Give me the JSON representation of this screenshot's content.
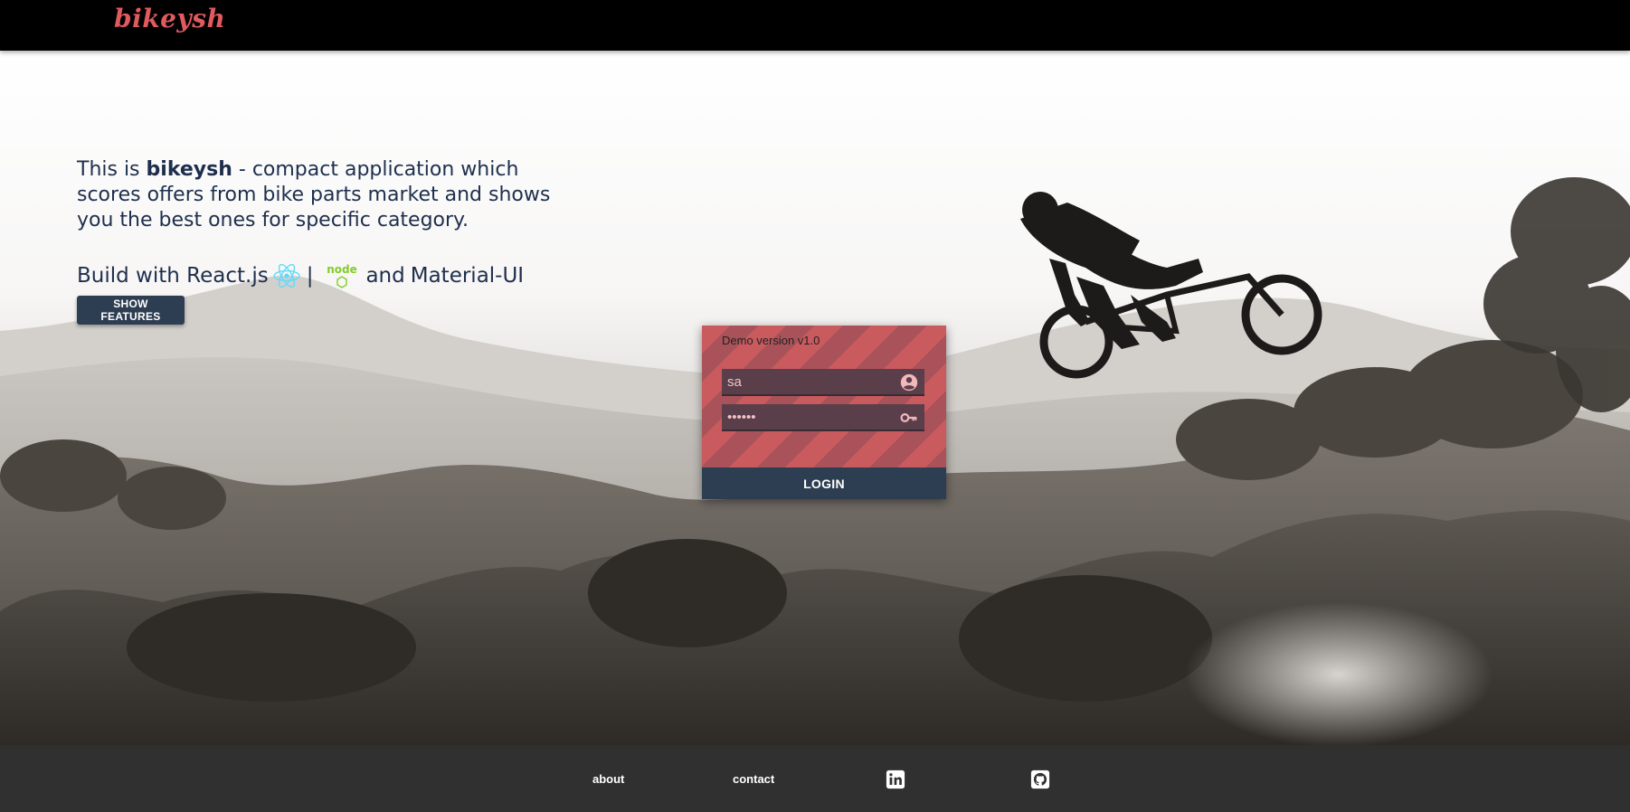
{
  "header": {
    "logo": "bikeysh"
  },
  "hero": {
    "intro_prefix": "This is ",
    "intro_brand": "bikeysh",
    "intro_rest": " - compact application which scores offers from bike parts market and shows you the best ones for specific category.",
    "build_prefix": "Build with React.js",
    "build_sep": "|",
    "build_and": "and",
    "build_mui": "Material-UI",
    "node_logo_text": "node",
    "features_button": "SHOW FEATURES"
  },
  "login": {
    "demo_label": "Demo version v1.0",
    "username_value": "sa",
    "password_value": "••••••",
    "login_button": "LOGIN",
    "username_icon": "account-circle-icon",
    "password_icon": "key-icon"
  },
  "footer": {
    "links": [
      "about",
      "contact"
    ],
    "social_icons": [
      "linkedin-icon",
      "github-icon"
    ]
  },
  "colors": {
    "brand": "#e05a5e",
    "header_bg": "#000000",
    "footer_bg": "#303030",
    "button_bg": "#2e3e52",
    "card_stripe_light": "#c95a5d",
    "card_stripe_dark": "#a9525a",
    "text_dark": "#1e2f4d",
    "react_blue": "#61dafb",
    "node_green": "#83cd29"
  }
}
